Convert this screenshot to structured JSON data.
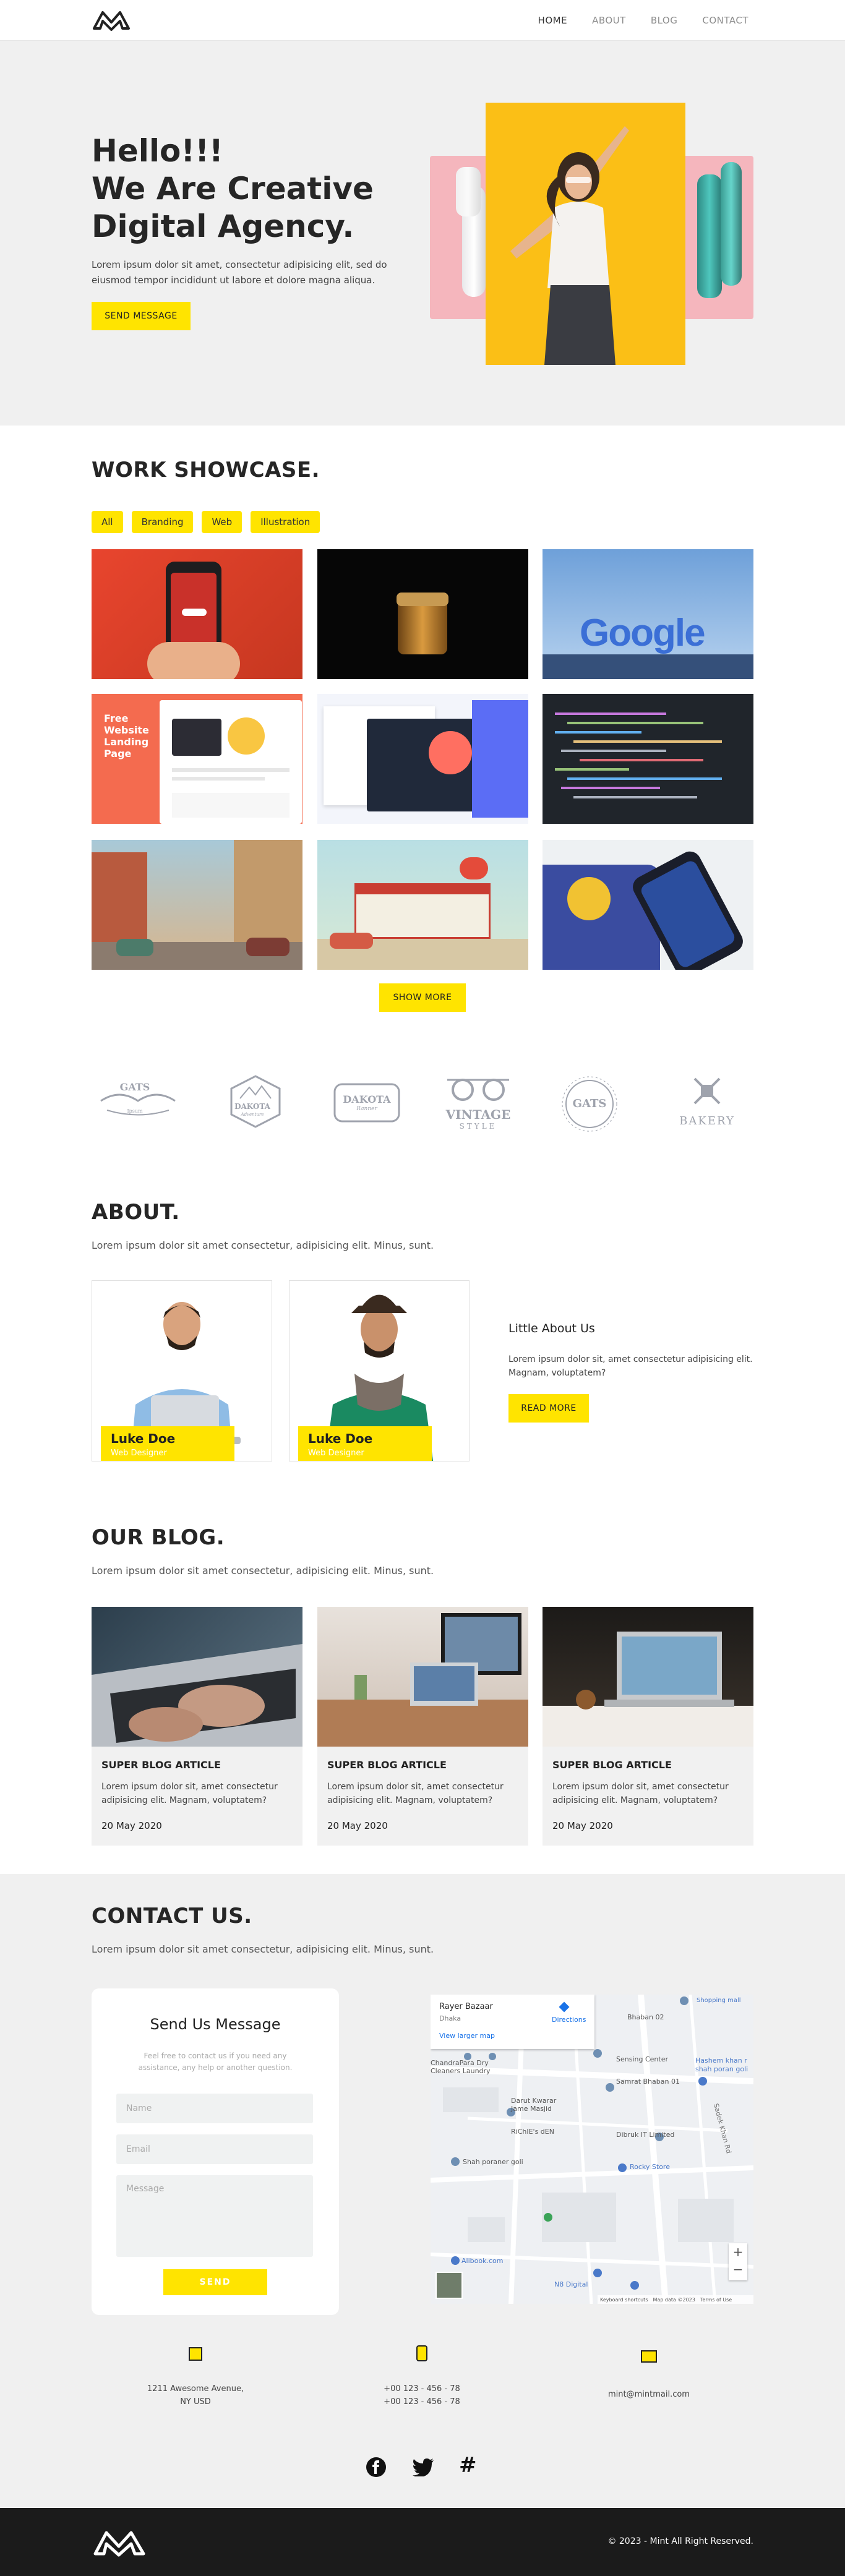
{
  "nav": {
    "items": [
      {
        "label": "HOME"
      },
      {
        "label": "ABOUT"
      },
      {
        "label": "BLOG"
      },
      {
        "label": "CONTACT"
      }
    ]
  },
  "hero": {
    "line1": "Hello!!!",
    "line2": "We Are Creative",
    "line3": "Digital Agency.",
    "text": "Lorem ipsum dolor sit amet, consectetur adipisicing elit, sed do eiusmod tempor incididunt ut labore et dolore magna aliqua.",
    "button": "SEND MESSAGE"
  },
  "showcase": {
    "title": "WORK SHOWCASE.",
    "filters": [
      "All",
      "Branding",
      "Web",
      "Illustration"
    ],
    "button": "SHOW MORE",
    "google_text": "Google",
    "landing_tag": "Free Website Landing Page"
  },
  "brands": [
    {
      "name": "GATS",
      "sub": "Ipsum"
    },
    {
      "name": "DAKOTA",
      "sub": "Adventure"
    },
    {
      "name": "DAKOTA",
      "sub": "Ranner"
    },
    {
      "name": "VINTAGE",
      "sub": "STYLE"
    },
    {
      "name": "GATS",
      "sub": ""
    },
    {
      "name": "BAKERY",
      "sub": ""
    }
  ],
  "about": {
    "title": "ABOUT.",
    "lead": "Lorem ipsum dolor sit amet consectetur, adipisicing elit. Minus, sunt.",
    "members": [
      {
        "name": "Luke Doe",
        "role": "Web Designer"
      },
      {
        "name": "Luke Doe",
        "role": "Web Designer"
      }
    ],
    "side_title": "Little About Us",
    "side_text": "Lorem ipsum dolor sit, amet consectetur adipisicing elit. Magnam, voluptatem?",
    "button": "READ MORE"
  },
  "blog": {
    "title": "OUR BLOG.",
    "lead": "Lorem ipsum dolor sit amet consectetur, adipisicing elit. Minus, sunt.",
    "cards": [
      {
        "title": "SUPER BLOG ARTICLE",
        "text": "Lorem ipsum dolor sit, amet consectetur adipisicing elit. Magnam, voluptatem?",
        "date": "20 May 2020"
      },
      {
        "title": "SUPER BLOG ARTICLE",
        "text": "Lorem ipsum dolor sit, amet consectetur adipisicing elit. Magnam, voluptatem?",
        "date": "20 May 2020"
      },
      {
        "title": "SUPER BLOG ARTICLE",
        "text": "Lorem ipsum dolor sit, amet consectetur adipisicing elit. Magnam, voluptatem?",
        "date": "20 May 2020"
      }
    ]
  },
  "contact": {
    "title": "CONTACT US.",
    "lead": "Lorem ipsum dolor sit amet consectetur, adipisicing elit. Minus, sunt.",
    "form": {
      "title": "Send Us Message",
      "hint": "Feel free to contact us if you need any assistance, any help or another question.",
      "name_placeholder": "Name",
      "email_placeholder": "Email",
      "message_placeholder": "Message",
      "button": "SEND"
    },
    "map": {
      "place": "Rayer Bazaar",
      "city": "Dhaka",
      "directions": "Directions",
      "larger": "View larger map",
      "labels": [
        "Shopping mall",
        "Bhaban 02",
        "Sensing Center",
        "Hashem khan r",
        "shah poran goli",
        "ChandraPara Dry Cleaners Laundry",
        "Samrat Bhaban 01",
        "Darut Kwarar Jame Masjid",
        "RiChIE's dEN",
        "Dibruk IT Limited",
        "Rocky Store",
        "Shah poraner goli",
        "Alibook.com",
        "N8 Digital",
        "Sadek Khan Rd"
      ],
      "footer_keys": "Keyboard shortcuts",
      "footer_data": "Map data ©2023",
      "footer_terms": "Terms of Use",
      "zoom_in": "+",
      "zoom_out": "−"
    },
    "info": {
      "address1": "1211 Awesome Avenue,",
      "address2": "NY USD",
      "phone1": "+00 123 - 456 - 78",
      "phone2": "+00 123 - 456 - 78",
      "email": "mint@mintmail.com"
    },
    "social": {
      "hash": "#"
    }
  },
  "footer": {
    "copy": "© 2023 - Mint All Right Reserved."
  },
  "colors": {
    "accent": "#ffe400",
    "dark": "#1b1b1b",
    "bg": "#f0f0f0"
  }
}
